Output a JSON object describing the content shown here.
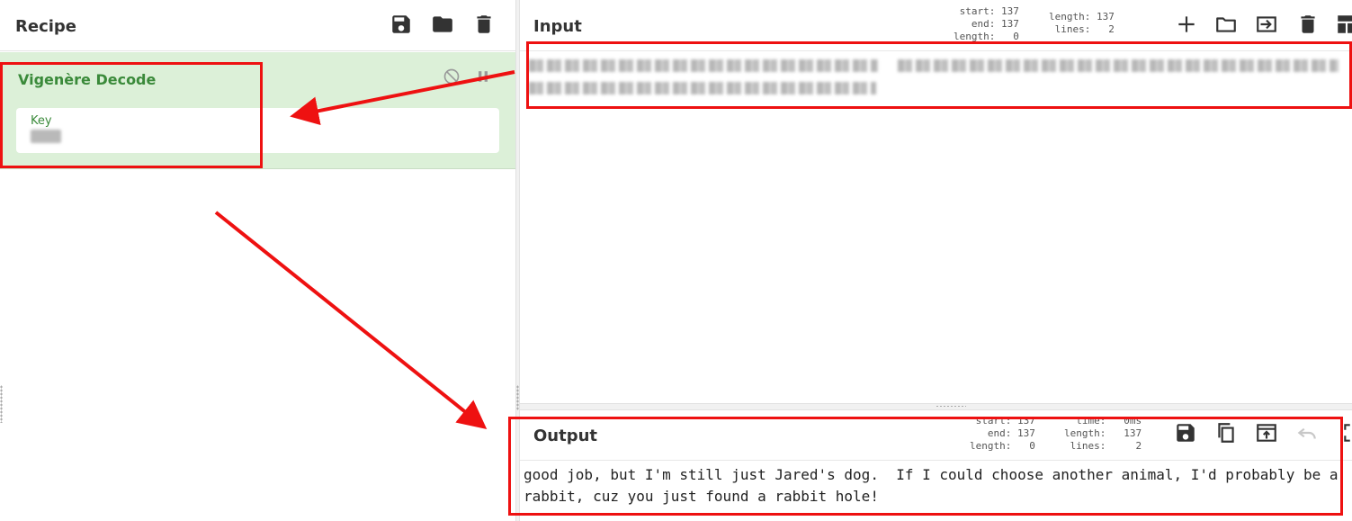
{
  "recipe": {
    "title": "Recipe",
    "icons": [
      "save-icon",
      "folder-icon",
      "trash-icon"
    ],
    "operation": {
      "name": "Vigenère Decode",
      "arg_label": "Key",
      "icons": [
        "disable-icon",
        "pause-icon"
      ]
    }
  },
  "input": {
    "title": "Input",
    "stats_left": "start: 137\n  end: 137\nlength:   0",
    "stats_right": "length: 137\n lines:   2",
    "icons": [
      "plus-icon",
      "open-folder-icon",
      "import-icon",
      "trash-icon",
      "layout-icon"
    ]
  },
  "output": {
    "title": "Output",
    "stats_left": "start: 137\n  end: 137\nlength:   0",
    "stats_right": "  time:   0ms\nlength:   137\n lines:     2",
    "icons": [
      "save-icon",
      "copy-icon",
      "move-to-input-icon",
      "undo-icon"
    ],
    "text": "good job, but I'm still just Jared's dog.  If I could choose another animal, I'd probably be a rabbit, cuz you just found a rabbit hole!"
  },
  "colors": {
    "operation_bg": "#dcf0d8",
    "operation_title": "#3a8a3a",
    "annotation": "#ee1111"
  }
}
